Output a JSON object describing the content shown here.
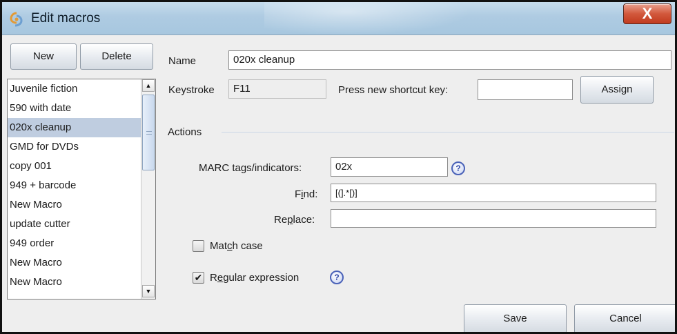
{
  "window": {
    "title": "Edit macros",
    "close_label": "X"
  },
  "toolbar": {
    "new_label": "New",
    "delete_label": "Delete"
  },
  "macro_list": {
    "items": [
      {
        "label": "Juvenile fiction",
        "selected": false
      },
      {
        "label": "590 with date",
        "selected": false
      },
      {
        "label": "020x cleanup",
        "selected": true
      },
      {
        "label": "GMD for DVDs",
        "selected": false
      },
      {
        "label": "copy 001",
        "selected": false
      },
      {
        "label": "949 + barcode",
        "selected": false
      },
      {
        "label": "New Macro",
        "selected": false
      },
      {
        "label": "update cutter",
        "selected": false
      },
      {
        "label": "949 order",
        "selected": false
      },
      {
        "label": "New Macro",
        "selected": false
      },
      {
        "label": "New Macro",
        "selected": false
      }
    ],
    "scroll_up_icon": "triangle-up",
    "scroll_down_icon": "triangle-down"
  },
  "form": {
    "name_label": "Name",
    "name_value": "020x cleanup",
    "keystroke_label": "Keystroke",
    "keystroke_value": "F11",
    "shortcut_label": "Press new shortcut key:",
    "shortcut_value": "",
    "assign_label": "Assign",
    "actions_label": "Actions",
    "marc_label_pre": "MARC tags/indicators:",
    "marc_value": "02x",
    "find_label_a": "F",
    "find_label_u": "i",
    "find_label_b": "nd:",
    "find_value": "[(].*[)]",
    "replace_label_a": "Re",
    "replace_label_u": "p",
    "replace_label_b": "lace:",
    "replace_value": "",
    "match_case_a": "Mat",
    "match_case_u": "c",
    "match_case_b": "h case",
    "match_case_checked": false,
    "regex_a": "R",
    "regex_u": "e",
    "regex_b": "gular expression",
    "regex_checked": true,
    "check_mark": "✔",
    "help_glyph": "?"
  },
  "footer": {
    "save_label": "Save",
    "cancel_label": "Cancel"
  },
  "colors": {
    "selection": "#bfcde0",
    "close_button": "#c13b1f",
    "help_icon": "#4a62b8"
  }
}
